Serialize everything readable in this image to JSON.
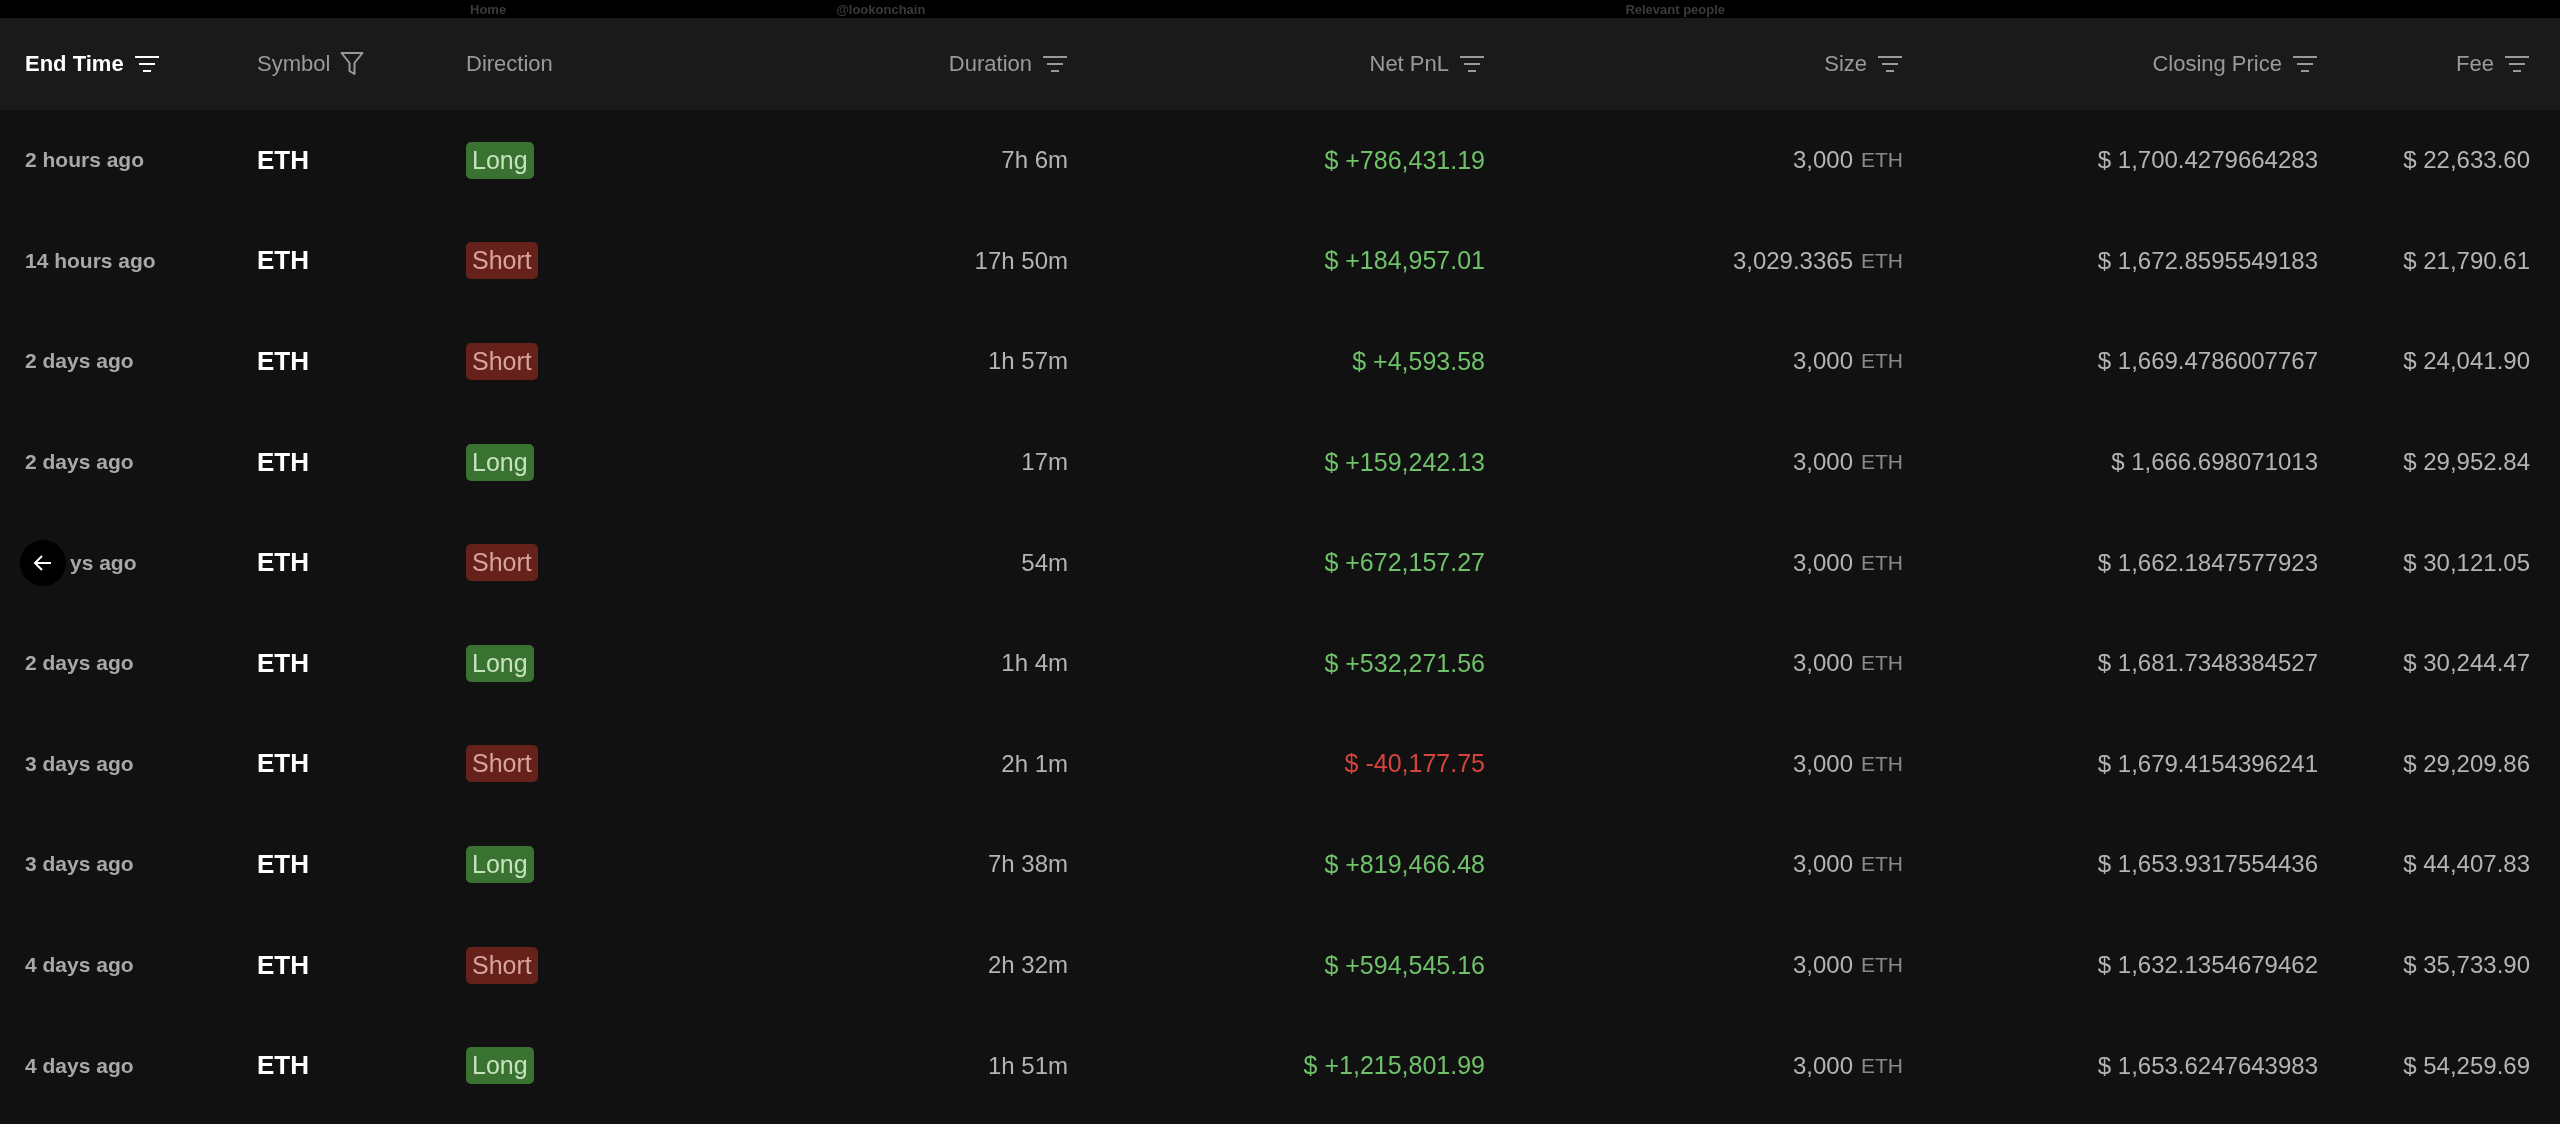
{
  "background_nav": [
    {
      "text": "Home"
    },
    {
      "text": "@lookonchain"
    },
    {
      "text": "Relevant people"
    }
  ],
  "columns": [
    {
      "label": "End Time",
      "active": true
    },
    {
      "label": "Symbol",
      "active": false
    },
    {
      "label": "Direction",
      "active": false
    },
    {
      "label": "Duration",
      "active": false
    },
    {
      "label": "Net PnL",
      "active": false
    },
    {
      "label": "Size",
      "active": false
    },
    {
      "label": "Closing Price",
      "active": false
    },
    {
      "label": "Fee",
      "active": false
    }
  ],
  "rows": [
    {
      "end_time": "2 hours ago",
      "symbol": "ETH",
      "direction": "Long",
      "kind": "long",
      "duration": "7h 6m",
      "pnl": "$ +786,431.19",
      "profit": true,
      "size": "3,000",
      "unit": "ETH",
      "closing_price": "$ 1,700.4279664283",
      "fee": "$ 22,633.60",
      "back_button": false
    },
    {
      "end_time": "14 hours ago",
      "symbol": "ETH",
      "direction": "Short",
      "kind": "short",
      "duration": "17h 50m",
      "pnl": "$ +184,957.01",
      "profit": true,
      "size": "3,029.3365",
      "unit": "ETH",
      "closing_price": "$ 1,672.8595549183",
      "fee": "$ 21,790.61",
      "back_button": false
    },
    {
      "end_time": "2 days ago",
      "symbol": "ETH",
      "direction": "Short",
      "kind": "short",
      "duration": "1h 57m",
      "pnl": "$ +4,593.58",
      "profit": true,
      "size": "3,000",
      "unit": "ETH",
      "closing_price": "$ 1,669.4786007767",
      "fee": "$ 24,041.90",
      "back_button": false
    },
    {
      "end_time": "2 days ago",
      "symbol": "ETH",
      "direction": "Long",
      "kind": "long",
      "duration": "17m",
      "pnl": "$ +159,242.13",
      "profit": true,
      "size": "3,000",
      "unit": "ETH",
      "closing_price": "$ 1,666.698071013",
      "fee": "$ 29,952.84",
      "back_button": false
    },
    {
      "end_time": "ys ago",
      "symbol": "ETH",
      "direction": "Short",
      "kind": "short",
      "duration": "54m",
      "pnl": "$ +672,157.27",
      "profit": true,
      "size": "3,000",
      "unit": "ETH",
      "closing_price": "$ 1,662.1847577923",
      "fee": "$ 30,121.05",
      "back_button": true
    },
    {
      "end_time": "2 days ago",
      "symbol": "ETH",
      "direction": "Long",
      "kind": "long",
      "duration": "1h 4m",
      "pnl": "$ +532,271.56",
      "profit": true,
      "size": "3,000",
      "unit": "ETH",
      "closing_price": "$ 1,681.7348384527",
      "fee": "$ 30,244.47",
      "back_button": false
    },
    {
      "end_time": "3 days ago",
      "symbol": "ETH",
      "direction": "Short",
      "kind": "short",
      "duration": "2h 1m",
      "pnl": "$ -40,177.75",
      "profit": false,
      "size": "3,000",
      "unit": "ETH",
      "closing_price": "$ 1,679.4154396241",
      "fee": "$ 29,209.86",
      "back_button": false
    },
    {
      "end_time": "3 days ago",
      "symbol": "ETH",
      "direction": "Long",
      "kind": "long",
      "duration": "7h 38m",
      "pnl": "$ +819,466.48",
      "profit": true,
      "size": "3,000",
      "unit": "ETH",
      "closing_price": "$ 1,653.9317554436",
      "fee": "$ 44,407.83",
      "back_button": false
    },
    {
      "end_time": "4 days ago",
      "symbol": "ETH",
      "direction": "Short",
      "kind": "short",
      "duration": "2h 32m",
      "pnl": "$ +594,545.16",
      "profit": true,
      "size": "3,000",
      "unit": "ETH",
      "closing_price": "$ 1,632.1354679462",
      "fee": "$ 35,733.90",
      "back_button": false
    },
    {
      "end_time": "4 days ago",
      "symbol": "ETH",
      "direction": "Long",
      "kind": "long",
      "duration": "1h 51m",
      "pnl": "$ +1,215,801.99",
      "profit": true,
      "size": "3,000",
      "unit": "ETH",
      "closing_price": "$ 1,653.6247643983",
      "fee": "$ 54,259.69",
      "back_button": false
    }
  ]
}
